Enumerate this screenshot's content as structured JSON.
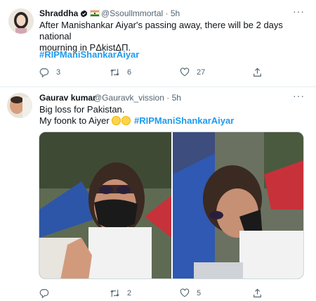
{
  "tweets": [
    {
      "author": "Shraddha",
      "handle": "@Ssoullmmortal",
      "time": "· 5h",
      "text_line1": "After Manishankar Aiyar's passing away, there will be 2 days national",
      "text_line2": "mourning in PΔkistΔΠ.",
      "hashtag": "#RIPManiShankarAiyar",
      "stats": {
        "replies": "3",
        "retweets": "6",
        "likes": "27"
      }
    },
    {
      "author": "Gaurav kumar",
      "handle": "@Gauravk_vission",
      "time": "· 5h",
      "text_line1": "Big loss for Pakistan.",
      "text_line2_prefix": "My foonk to Aiyer",
      "hashtag": "#RIPManiShankarAiyar",
      "stats": {
        "replies": "",
        "retweets": "2",
        "likes": "5"
      }
    }
  ],
  "icons": {
    "verified": "verified-badge-icon",
    "flag": "india-flag-icon",
    "more": "more-icon",
    "reply": "reply-icon",
    "retweet": "retweet-icon",
    "like": "like-icon",
    "share": "share-icon"
  },
  "colors": {
    "accent": "#1d9bf0",
    "text": "#0f1419",
    "muted": "#536471",
    "divider": "#e6ecf0"
  }
}
